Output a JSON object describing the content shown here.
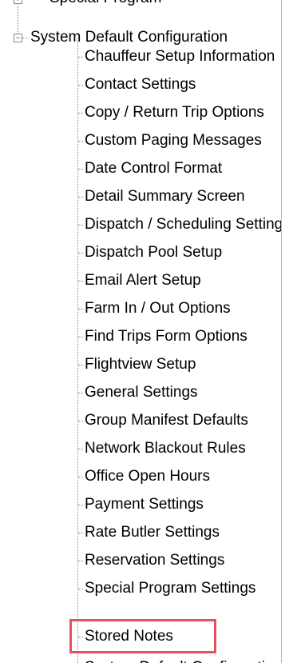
{
  "tree": {
    "top_item": {
      "label": "Special Program",
      "expander": "+"
    },
    "system_node": {
      "label": "System Default Configuration",
      "expander": "−"
    },
    "children": [
      {
        "label": "Chauffeur Setup Information"
      },
      {
        "label": "Contact Settings"
      },
      {
        "label": "Copy / Return Trip Options"
      },
      {
        "label": "Custom Paging Messages"
      },
      {
        "label": "Date Control Format"
      },
      {
        "label": "Detail Summary Screen"
      },
      {
        "label": "Dispatch / Scheduling Settings"
      },
      {
        "label": "Dispatch Pool Setup"
      },
      {
        "label": "Email Alert Setup"
      },
      {
        "label": "Farm In / Out Options"
      },
      {
        "label": "Find Trips Form Options"
      },
      {
        "label": "Flightview Setup"
      },
      {
        "label": "General Settings"
      },
      {
        "label": "Group Manifest Defaults"
      },
      {
        "label": "Network Blackout Rules"
      },
      {
        "label": "Office Open Hours"
      },
      {
        "label": "Payment Settings"
      },
      {
        "label": "Rate Butler Settings"
      },
      {
        "label": "Reservation Settings"
      },
      {
        "label": "Special Program Settings"
      },
      {
        "label": "Stored Notes"
      },
      {
        "label": "System Default Configuration"
      }
    ],
    "highlighted_item": "Stored Notes",
    "highlight_color": "#e4505b"
  }
}
